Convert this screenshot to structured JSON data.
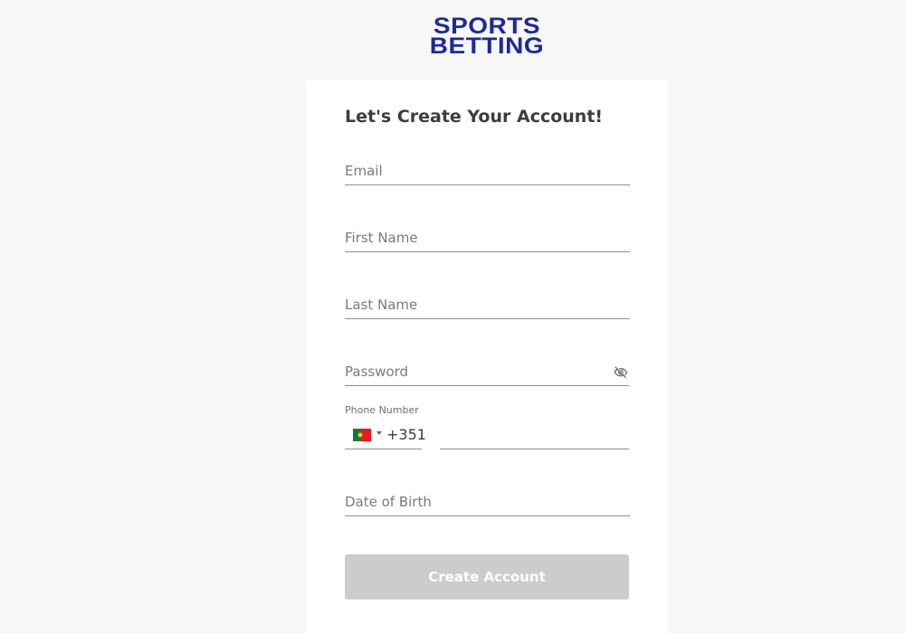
{
  "logo": {
    "line1": "SPORTS",
    "line2": "BETTING",
    "color": "#1b2a9b"
  },
  "form": {
    "title": "Let's Create Your Account!",
    "email": {
      "placeholder": "Email",
      "value": ""
    },
    "first_name": {
      "placeholder": "First Name",
      "value": ""
    },
    "last_name": {
      "placeholder": "Last Name",
      "value": ""
    },
    "password": {
      "placeholder": "Password",
      "value": "",
      "toggle_icon": "eye-off-icon"
    },
    "phone": {
      "label": "Phone Number",
      "country_flag": "portugal-flag",
      "dial_code": "+351",
      "value": ""
    },
    "dob": {
      "placeholder": "Date of Birth",
      "value": ""
    },
    "submit_label": "Create Account",
    "submit_state": "disabled",
    "submit_color": "#cccccc"
  }
}
